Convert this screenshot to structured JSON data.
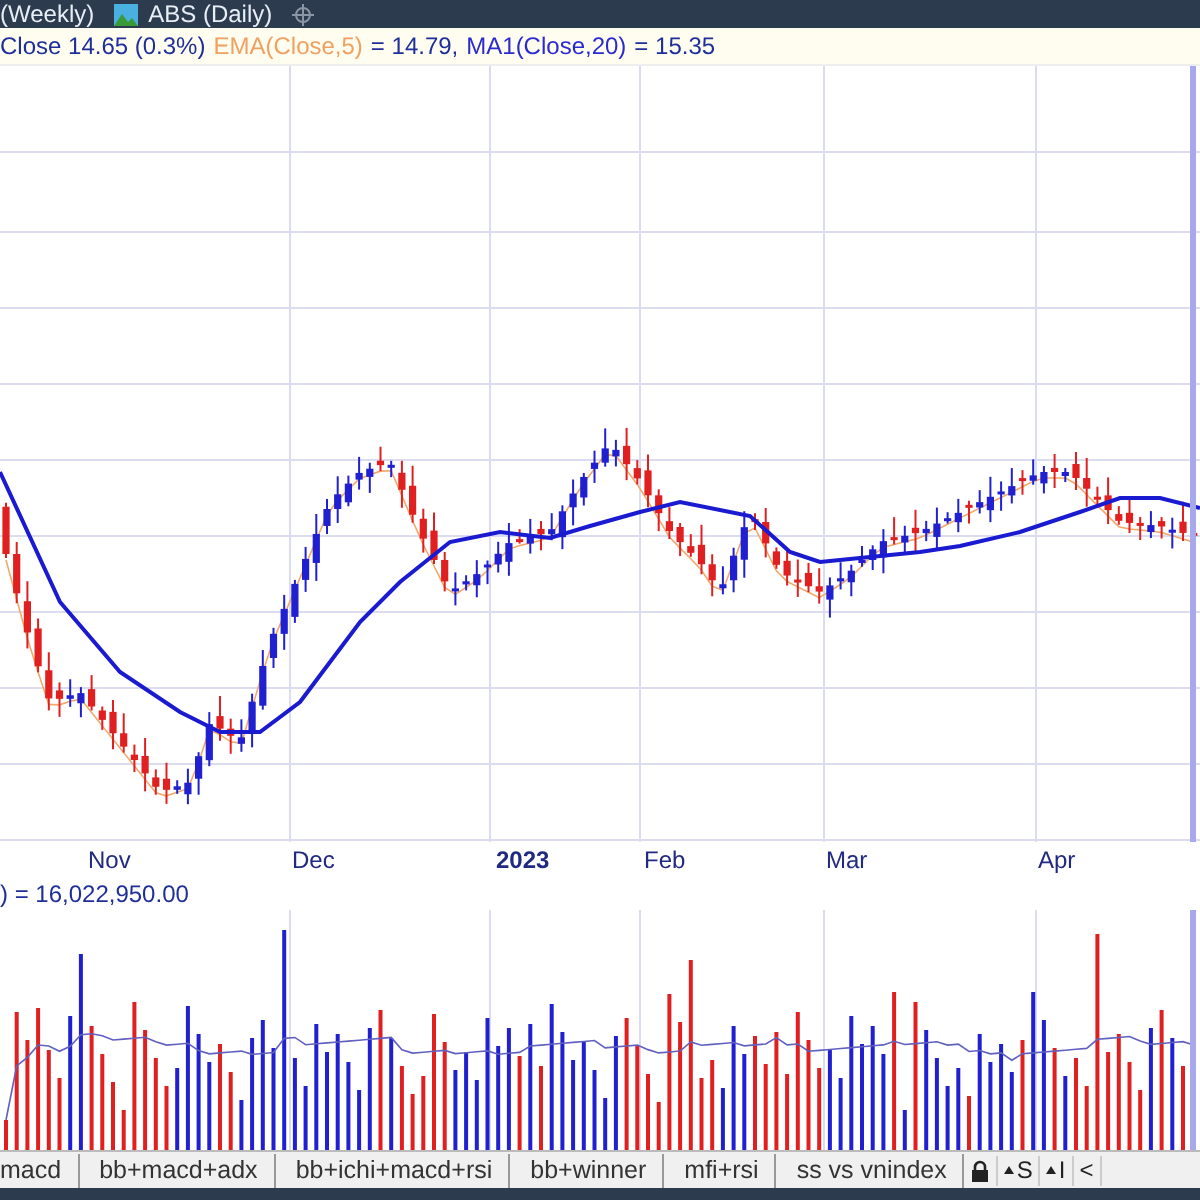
{
  "top_tabs": [
    {
      "label": "(Weekly)",
      "kind": "plain"
    },
    {
      "label": "ABS (Daily)",
      "kind": "chart"
    }
  ],
  "legend": [
    {
      "text": "Close 14.65 (0.3%)",
      "color": "#1f2f9a"
    },
    {
      "text": "EMA(Close,5)",
      "color": "#f0a060"
    },
    {
      "text": "= 14.79,",
      "color": "#1f2f9a"
    },
    {
      "text": "MA1(Close,20)",
      "color": "#2a2ad0"
    },
    {
      "text": "= 15.35",
      "color": "#1f2f9a"
    }
  ],
  "x_axis": [
    {
      "label": "Nov",
      "bold": false
    },
    {
      "label": "Dec",
      "bold": false
    },
    {
      "label": "2023",
      "bold": true
    },
    {
      "label": "Feb",
      "bold": false
    },
    {
      "label": "Mar",
      "bold": false
    },
    {
      "label": "Apr",
      "bold": false
    }
  ],
  "volume_legend": ") = 16,022,950.00",
  "sheet_tabs": [
    "macd",
    "bb+macd+adx",
    "bb+ichi+macd+rsi",
    "bb+winner",
    "mfi+rsi",
    "ss vs vnindex"
  ],
  "tool_buttons": [
    {
      "kind": "lock"
    },
    {
      "kind": "up",
      "label": "S"
    },
    {
      "kind": "up",
      "label": "I"
    },
    {
      "kind": "back",
      "label": "<"
    }
  ]
}
